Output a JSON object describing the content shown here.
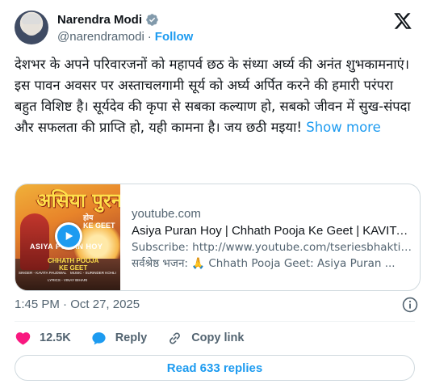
{
  "author": {
    "display_name": "Narendra Modi",
    "handle": "@narendramodi",
    "separator": "·",
    "follow_label": "Follow"
  },
  "tweet": {
    "text": "देशभर के अपने परिवारजनों को महापर्व छठ के संध्या अर्घ्य की अनंत शुभकामनाएं। इस पावन अवसर पर अस्ताचलगामी सूर्य को अर्घ्य अर्पित करने की हमारी परंपरा बहुत विशिष्ट है। सूर्यदेव की कृपा से सबका कल्याण हो, सबको जीवन में सुख-संपदा और सफलता की प्राप्ति हो, यही कामना है। जय छठी मइया!",
    "show_more_label": "Show more"
  },
  "link_card": {
    "domain": "youtube.com",
    "title": "Asiya Puran Hoy | Chhath Pooja Ke Geet | KAVITA P...",
    "description_line1": "Subscribe: http://www.youtube.com/tseriesbhakti🙏",
    "description_line2": "सर्वश्रेष्ठ भजन: 🙏 Chhath Pooja Geet: Asiya Puran ...",
    "thumbnail": {
      "title_text": "असिया पुरन",
      "title_suffix": "होय",
      "subtitle": "KE GEET",
      "caption": "ASIYA PURAN HOY",
      "badge_line1": "CHHATH POOJA",
      "badge_line2": "KE GEET",
      "credit1": "SINGER - KAVITA PAUDWAL",
      "credit2": "MUSIC - SURINDER KOHLI",
      "credit3": "LYRICS - VINAY BIHARI"
    }
  },
  "meta": {
    "time": "1:45 PM",
    "separator": "·",
    "date": "Oct 27, 2025"
  },
  "actions": {
    "likes": "12.5K",
    "reply_label": "Reply",
    "copy_link_label": "Copy link"
  },
  "read_replies_label": "Read 633 replies",
  "colors": {
    "accent": "#1d9bf0",
    "like": "#f91880",
    "text": "#0f1419",
    "muted": "#536471"
  },
  "icons": [
    "verified-badge-icon",
    "x-logo-icon",
    "play-icon",
    "info-icon",
    "heart-icon",
    "reply-bubble-icon",
    "link-icon"
  ]
}
